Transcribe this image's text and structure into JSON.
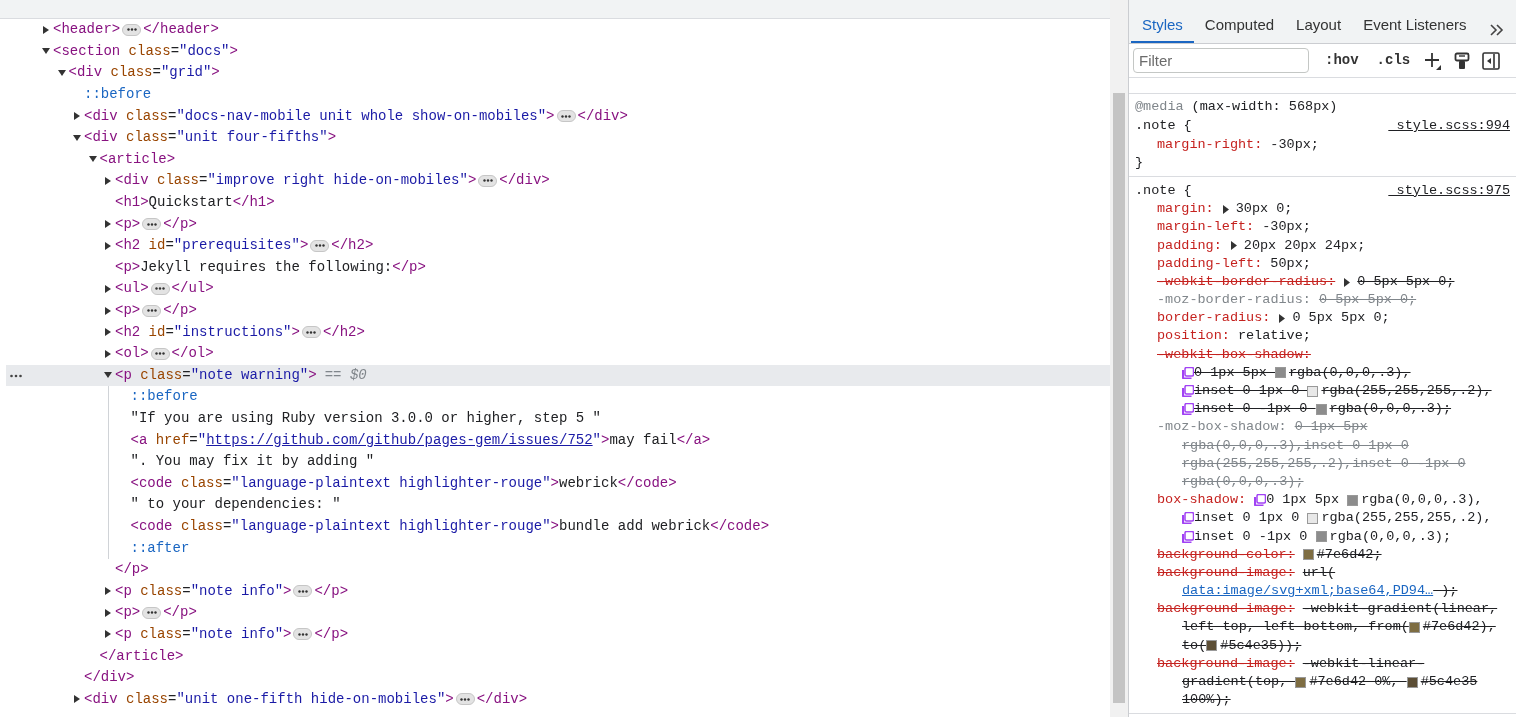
{
  "elements_tree": [
    {
      "kind": "element",
      "open": "<header>",
      "expanded": false,
      "close": "</header>",
      "selected": false
    },
    {
      "kind": "element",
      "open": "<section class=\"docs\">",
      "expanded": true,
      "selected": false,
      "children": [
        {
          "kind": "element",
          "open": "<div class=\"grid\">",
          "expanded": true,
          "selected": false,
          "children": [
            {
              "kind": "pseudo",
              "text": "::before",
              "selected": false
            },
            {
              "kind": "element",
              "open": "<div class=\"docs-nav-mobile unit whole show-on-mobiles\">",
              "expanded": false,
              "close": "</div>",
              "selected": false
            },
            {
              "kind": "element",
              "open": "<div class=\"unit four-fifths\">",
              "expanded": true,
              "close": "</div>",
              "selected": false,
              "children": [
                {
                  "kind": "element",
                  "open": "<article>",
                  "expanded": true,
                  "close": "</article>",
                  "selected": false,
                  "children": [
                    {
                      "kind": "element",
                      "open": "<div class=\"improve right hide-on-mobiles\">",
                      "expanded": false,
                      "close": "</div>",
                      "selected": false
                    },
                    {
                      "kind": "element",
                      "open": "<h1>Quickstart</h1>",
                      "selected": false
                    },
                    {
                      "kind": "element",
                      "open": "<p>",
                      "expanded": false,
                      "close": "</p>",
                      "selected": false
                    },
                    {
                      "kind": "element",
                      "open": "<h2 id=\"prerequisites\">",
                      "expanded": false,
                      "close": "</h2>",
                      "selected": false
                    },
                    {
                      "kind": "element",
                      "open": "<p>Jekyll requires the following:</p>",
                      "selected": false
                    },
                    {
                      "kind": "element",
                      "open": "<ul>",
                      "expanded": false,
                      "close": "</ul>",
                      "selected": false
                    },
                    {
                      "kind": "element",
                      "open": "<p>",
                      "expanded": false,
                      "close": "</p>",
                      "selected": false
                    },
                    {
                      "kind": "element",
                      "open": "<h2 id=\"instructions\">",
                      "expanded": false,
                      "close": "</h2>",
                      "selected": false
                    },
                    {
                      "kind": "element",
                      "open": "<ol>",
                      "expanded": false,
                      "close": "</ol>",
                      "selected": false
                    },
                    {
                      "kind": "element",
                      "open": "<p class=\"note warning\">",
                      "expanded": true,
                      "close": "</p>",
                      "selected": true,
                      "marker": "== $0",
                      "children": [
                        {
                          "kind": "pseudo",
                          "text": "::before",
                          "selected": false
                        },
                        {
                          "kind": "text",
                          "text": "\"If you are using Ruby version 3.0.0 or higher, step 5 \"",
                          "selected": false
                        },
                        {
                          "kind": "element",
                          "open": "<a href=\"",
                          "link": "https://github.com/github/pages-gem/issues/752",
                          "rest": "\">may fail</a>",
                          "selected": false
                        },
                        {
                          "kind": "text",
                          "text": "\". You may fix it by adding \"",
                          "selected": false
                        },
                        {
                          "kind": "element",
                          "open": "<code class=\"language-plaintext highlighter-rouge\">webrick</code>",
                          "selected": false
                        },
                        {
                          "kind": "text",
                          "text": "\" to your dependencies: \"",
                          "selected": false
                        },
                        {
                          "kind": "element",
                          "open": "<code class=\"language-plaintext highlighter-rouge\">bundle add webrick</code>",
                          "selected": false
                        },
                        {
                          "kind": "pseudo",
                          "text": "::after",
                          "selected": false
                        }
                      ]
                    },
                    {
                      "kind": "element",
                      "open": "<p class=\"note info\">",
                      "expanded": false,
                      "close": "</p>",
                      "selected": false
                    },
                    {
                      "kind": "element",
                      "open": "<p>",
                      "expanded": false,
                      "close": "</p>",
                      "selected": false
                    },
                    {
                      "kind": "element",
                      "open": "<p class=\"note info\">",
                      "expanded": false,
                      "close": "</p>",
                      "selected": false
                    }
                  ]
                }
              ]
            },
            {
              "kind": "element",
              "open": "<div class=\"unit one-fifth hide-on-mobiles\">",
              "expanded": false,
              "close": "</div>",
              "selected": false
            }
          ]
        }
      ]
    }
  ],
  "sidebar_tabs": [
    {
      "label": "Styles",
      "selected": true
    },
    {
      "label": "Computed",
      "selected": false
    },
    {
      "label": "Layout",
      "selected": false
    },
    {
      "label": "Event Listeners",
      "selected": false
    }
  ],
  "filter": {
    "placeholder": "Filter"
  },
  "toolbar_buttons": [
    ":hov",
    ".cls"
  ],
  "rules": [
    {
      "media": "@media",
      "query": "(max-width: 568px)",
      "selector": ".note {",
      "source": "_style.scss:994",
      "close": "}",
      "declarations": [
        {
          "name": "margin-right:",
          "kind": "active",
          "value": [
            {
              "kind": "text",
              "text": "-30px;"
            }
          ]
        }
      ]
    },
    {
      "selector": ".note {",
      "source": "_style.scss:975",
      "declarations": [
        {
          "name": "margin:",
          "kind": "active",
          "expander": true,
          "value": [
            {
              "kind": "text",
              "text": "30px 0;"
            }
          ]
        },
        {
          "name": "margin-left:",
          "kind": "active",
          "value": [
            {
              "kind": "text",
              "text": "-30px;"
            }
          ]
        },
        {
          "name": "padding:",
          "kind": "active",
          "expander": true,
          "value": [
            {
              "kind": "text",
              "text": "20px 20px 24px;"
            }
          ]
        },
        {
          "name": "padding-left:",
          "kind": "active",
          "value": [
            {
              "kind": "text",
              "text": "50px;"
            }
          ]
        },
        {
          "name": "-webkit-border-radius:",
          "kind": "overridden",
          "expander": true,
          "value": [
            {
              "kind": "text",
              "text": "0 5px 5px 0;"
            }
          ]
        },
        {
          "name": "-moz-border-radius:",
          "kind": "inactive",
          "value": [
            {
              "kind": "text",
              "text": "0 5px 5px 0;"
            }
          ]
        },
        {
          "name": "border-radius:",
          "kind": "active",
          "expander": true,
          "value": [
            {
              "kind": "text",
              "text": "0 5px 5px 0;"
            }
          ]
        },
        {
          "name": "position:",
          "kind": "active",
          "value": [
            {
              "kind": "text",
              "text": "relative;"
            }
          ]
        },
        {
          "name": "-webkit-box-shadow:",
          "kind": "overridden",
          "more": [
            [
              {
                "kind": "shadow"
              },
              {
                "kind": "text",
                "text": "0 1px 5px "
              },
              {
                "kind": "swatch",
                "color": "#8c8c8c"
              },
              {
                "kind": "text",
                "text": "rgba(0,0,0,.3),"
              }
            ],
            [
              {
                "kind": "shadow"
              },
              {
                "kind": "text",
                "text": "inset 0 1px 0 "
              },
              {
                "kind": "swatch",
                "color": "#e8e8e8"
              },
              {
                "kind": "text",
                "text": "rgba(255,255,255,.2),"
              }
            ],
            [
              {
                "kind": "shadow"
              },
              {
                "kind": "text",
                "text": "inset 0 -1px 0 "
              },
              {
                "kind": "swatch",
                "color": "#8c8c8c"
              },
              {
                "kind": "text",
                "text": "rgba(0,0,0,.3);"
              }
            ]
          ]
        },
        {
          "name": "-moz-box-shadow:",
          "kind": "inactive",
          "value": [
            {
              "kind": "text",
              "text": "0 1px 5px"
            }
          ],
          "more": [
            [
              {
                "kind": "text",
                "text": "rgba(0,0,0,.3),inset 0 1px 0"
              }
            ],
            [
              {
                "kind": "text",
                "text": "rgba(255,255,255,.2),inset 0 -1px 0"
              }
            ],
            [
              {
                "kind": "text",
                "text": "rgba(0,0,0,.3);"
              }
            ]
          ]
        },
        {
          "name": "box-shadow:",
          "kind": "active",
          "value": [
            {
              "kind": "shadow"
            },
            {
              "kind": "text",
              "text": "0 1px 5px "
            },
            {
              "kind": "swatch",
              "color": "#8c8c8c"
            },
            {
              "kind": "text",
              "text": "rgba(0,0,0,.3),"
            }
          ],
          "more": [
            [
              {
                "kind": "shadow"
              },
              {
                "kind": "text",
                "text": "inset 0 1px 0 "
              },
              {
                "kind": "swatch",
                "color": "#e8e8e8"
              },
              {
                "kind": "text",
                "text": "rgba(255,255,255,.2),"
              }
            ],
            [
              {
                "kind": "shadow"
              },
              {
                "kind": "text",
                "text": "inset 0 -1px 0 "
              },
              {
                "kind": "swatch",
                "color": "#8c8c8c"
              },
              {
                "kind": "text",
                "text": "rgba(0,0,0,.3);"
              }
            ]
          ]
        },
        {
          "name": "background-color:",
          "kind": "overridden",
          "value": [
            {
              "kind": "swatch",
              "color": "#7e6d42"
            },
            {
              "kind": "text",
              "text": "#7e6d42;"
            }
          ]
        },
        {
          "name": "background-image:",
          "kind": "overridden",
          "value": [
            {
              "kind": "text",
              "text": "url("
            }
          ],
          "more": [
            [
              {
                "kind": "link",
                "text": "data:image/svg+xml;base64,PD94…"
              },
              {
                "kind": "text",
                "text": " );"
              }
            ]
          ]
        },
        {
          "name": "background-image:",
          "kind": "overridden",
          "value": [
            {
              "kind": "text",
              "text": "-webkit-gradient(linear,"
            }
          ],
          "more": [
            [
              {
                "kind": "text",
                "text": "left top, left bottom, from("
              },
              {
                "kind": "swatch",
                "color": "#7e6d42"
              },
              {
                "kind": "text",
                "text": "#7e6d42),"
              }
            ],
            [
              {
                "kind": "text",
                "text": "to("
              },
              {
                "kind": "swatch",
                "color": "#5c4e35"
              },
              {
                "kind": "text",
                "text": "#5c4e35));"
              }
            ]
          ]
        },
        {
          "name": "background-image:",
          "kind": "overridden",
          "value": [
            {
              "kind": "text",
              "text": "-webkit-linear-"
            }
          ],
          "more": [
            [
              {
                "kind": "text",
                "text": "gradient(top, "
              },
              {
                "kind": "swatch",
                "color": "#7e6d42"
              },
              {
                "kind": "text",
                "text": "#7e6d42 0%, "
              },
              {
                "kind": "swatch",
                "color": "#5c4e35"
              },
              {
                "kind": "text",
                "text": "#5c4e35"
              }
            ],
            [
              {
                "kind": "text",
                "text": "100%);"
              }
            ]
          ]
        }
      ]
    }
  ]
}
